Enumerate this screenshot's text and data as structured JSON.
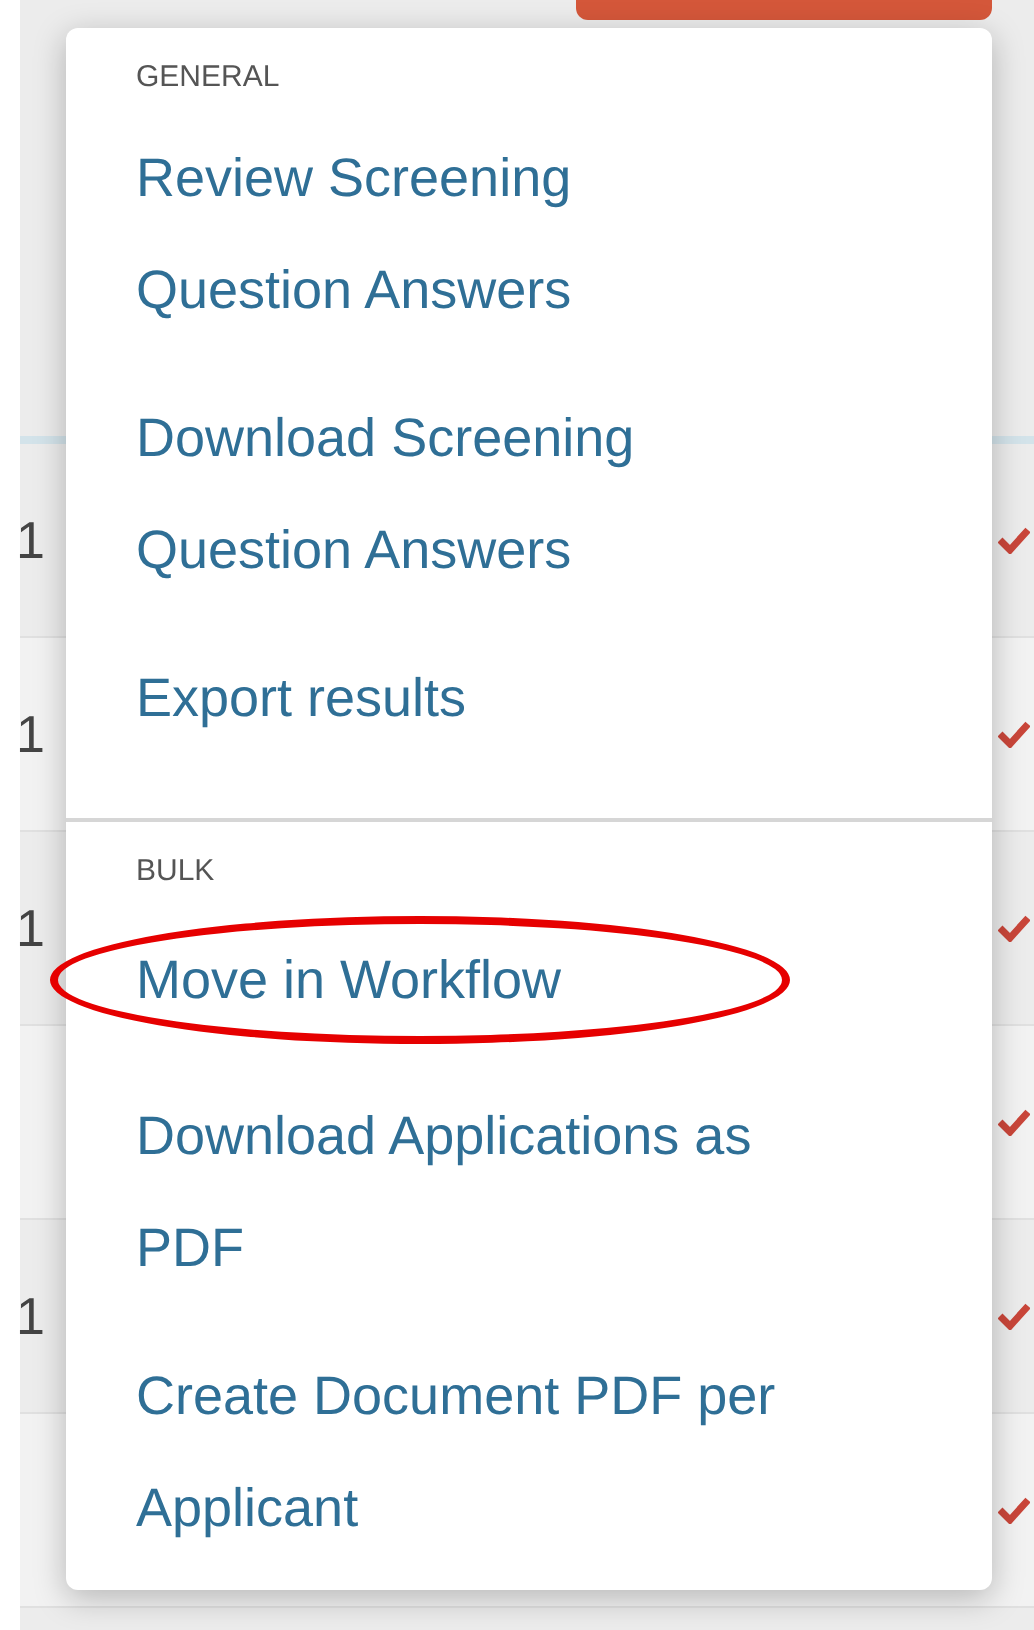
{
  "rows": [
    {
      "cell": "1",
      "checked": true
    },
    {
      "cell": "1",
      "checked": true
    },
    {
      "cell": "1",
      "checked": true
    },
    {
      "checked": true
    },
    {
      "cell": "1",
      "checked": true
    },
    {
      "checked": true
    }
  ],
  "menu": {
    "sections": [
      {
        "header": "GENERAL",
        "items": [
          {
            "label": "Review Screening Question Answers",
            "highlighted": false
          },
          {
            "label": "Download Screening Question Answers",
            "highlighted": false
          },
          {
            "label": "Export results",
            "highlighted": false
          }
        ]
      },
      {
        "header": "BULK",
        "items": [
          {
            "label": "Move in Workflow",
            "highlighted": true
          },
          {
            "label": "Download Applications as PDF",
            "highlighted": false
          },
          {
            "label": "Create Document PDF per Applicant",
            "highlighted": false
          }
        ]
      }
    ]
  }
}
